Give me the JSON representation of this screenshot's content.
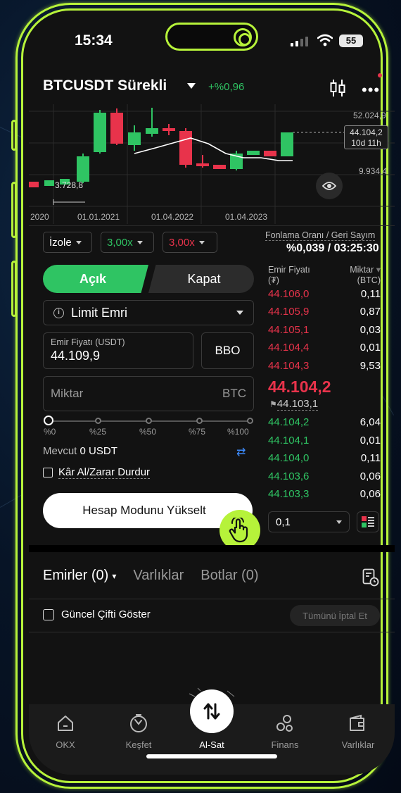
{
  "status_bar": {
    "time": "15:34",
    "battery": "55"
  },
  "header": {
    "pair": "BTCUSDT Sürekli",
    "change": "+%0,96"
  },
  "chart": {
    "price_high": "52.024,9",
    "price_mid": "9.934,4",
    "price_low": "3.728,8",
    "current_price": "44.104,2",
    "countdown": "10d 11h",
    "x_labels": [
      "2020",
      "01.01.2021",
      "01.04.2022",
      "01.04.2023"
    ]
  },
  "controls": {
    "margin_mode": "İzole",
    "leverage_long": "3,00x",
    "leverage_short": "3,00x",
    "funding_label": "Fonlama Oranı / Geri Sayım",
    "funding_value": "%0,039 / 03:25:30"
  },
  "order_form": {
    "open": "Açık",
    "close": "Kapat",
    "order_type": "Limit Emri",
    "price_label": "Emir Fiyatı (USDT)",
    "price_value": "44.109,9",
    "bbo": "BBO",
    "qty_placeholder": "Miktar",
    "qty_unit": "BTC",
    "pct_labels": [
      "%0",
      "%25",
      "%50",
      "%75",
      "%100"
    ],
    "available_label": "Mevcut",
    "available_value": "0 USDT",
    "tpsl_label": "Kâr Al/Zarar Durdur",
    "upgrade_button": "Hesap Modunu Yükselt"
  },
  "orderbook": {
    "price_header": "Emir Fiyatı",
    "price_unit": "(₮)",
    "qty_header": "Miktar",
    "qty_unit": "(BTC)",
    "asks": [
      {
        "price": "44.106,0",
        "qty": "0,11"
      },
      {
        "price": "44.105,9",
        "qty": "0,87"
      },
      {
        "price": "44.105,1",
        "qty": "0,03"
      },
      {
        "price": "44.104,4",
        "qty": "0,01"
      },
      {
        "price": "44.104,3",
        "qty": "9,53"
      }
    ],
    "last_price": "44.104,2",
    "mark_price": "44.103,1",
    "bids": [
      {
        "price": "44.104,2",
        "qty": "6,04"
      },
      {
        "price": "44.104,1",
        "qty": "0,01"
      },
      {
        "price": "44.104,0",
        "qty": "0,11"
      },
      {
        "price": "44.103,6",
        "qty": "0,06"
      },
      {
        "price": "44.103,3",
        "qty": "0,06"
      }
    ],
    "depth": "0,1"
  },
  "bottom_tabs": {
    "orders": "Emirler (0)",
    "assets": "Varlıklar",
    "bots": "Botlar (0)",
    "show_current": "Güncel Çifti Göster",
    "cancel_all": "Tümünü İptal Et"
  },
  "nav": {
    "items": [
      "OKX",
      "Keşfet",
      "Al-Sat",
      "Finans",
      "Varlıklar"
    ]
  },
  "colors": {
    "accent": "#b6f23a",
    "green": "#2fc463",
    "red": "#e8334b"
  }
}
